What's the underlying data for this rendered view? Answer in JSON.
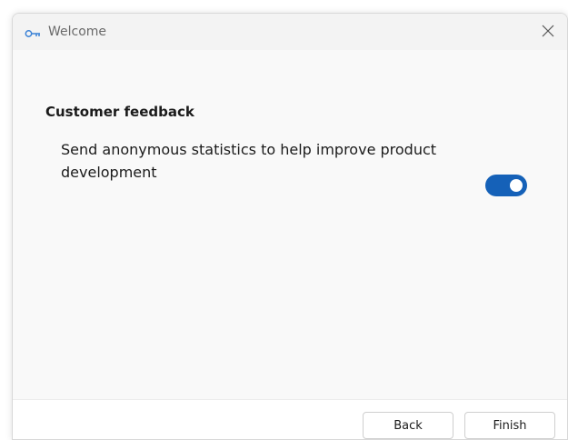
{
  "window": {
    "title": "Welcome",
    "icon": "key-icon",
    "close_icon": "close-icon"
  },
  "section": {
    "heading": "Customer feedback"
  },
  "setting": {
    "label": "Send anonymous statistics to help improve product development",
    "toggle_on": true
  },
  "footer": {
    "back_label": "Back",
    "finish_label": "Finish"
  },
  "colors": {
    "accent": "#1561b8",
    "background": "#f9f9f9"
  }
}
